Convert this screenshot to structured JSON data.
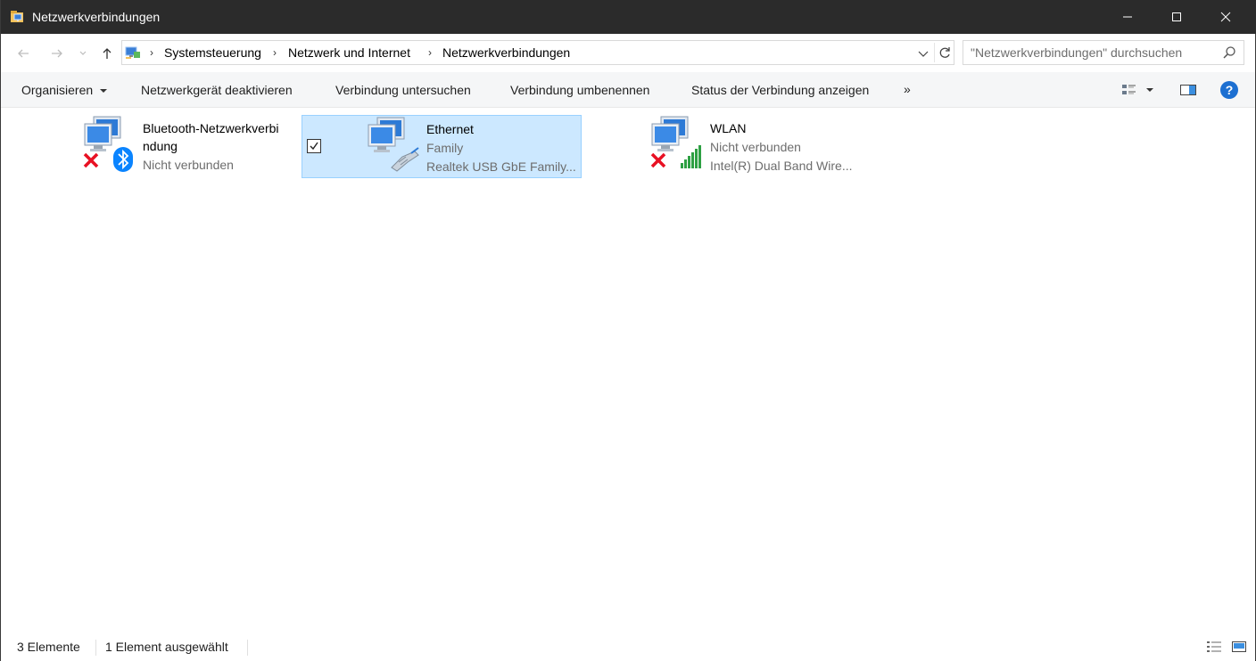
{
  "window": {
    "title": "Netzwerkverbindungen",
    "app_icon": "network-folder-icon"
  },
  "nav": {
    "back_icon": "arrow-left-icon",
    "forward_icon": "arrow-right-icon",
    "recent_icon": "chevron-down-icon",
    "up_icon": "arrow-up-icon",
    "breadcrumb": [
      "Systemsteuerung",
      "Netzwerk und Internet",
      "Netzwerkverbindungen"
    ],
    "search_placeholder": "\"Netzwerkverbindungen\" durchsuchen"
  },
  "toolbar": {
    "organize": "Organisieren",
    "disable": "Netzwerkgerät deaktivieren",
    "diagnose": "Verbindung untersuchen",
    "rename": "Verbindung umbenennen",
    "status": "Status der Verbindung anzeigen",
    "more": "»"
  },
  "connections": [
    {
      "name_line1": "Bluetooth-Netzwerkverbi",
      "name_line2": "ndung",
      "status": "Nicht verbunden",
      "adapter": "",
      "selected": false,
      "icon": "bluetooth-network-icon"
    },
    {
      "name": "Ethernet",
      "status": "Family",
      "adapter": "Realtek USB GbE Family...",
      "selected": true,
      "icon": "ethernet-network-icon"
    },
    {
      "name": "WLAN",
      "status": "Nicht verbunden",
      "adapter": "Intel(R) Dual Band Wire...",
      "selected": false,
      "icon": "wifi-network-icon"
    }
  ],
  "statusbar": {
    "count": "3 Elemente",
    "selection": "1 Element ausgewählt"
  },
  "colors": {
    "titlebar": "#2b2b2b",
    "selection_bg": "#cce8ff",
    "selection_border": "#99d1ff",
    "help_blue": "#1c6fd1",
    "error_red": "#e81123",
    "signal_green": "#2ea043"
  }
}
